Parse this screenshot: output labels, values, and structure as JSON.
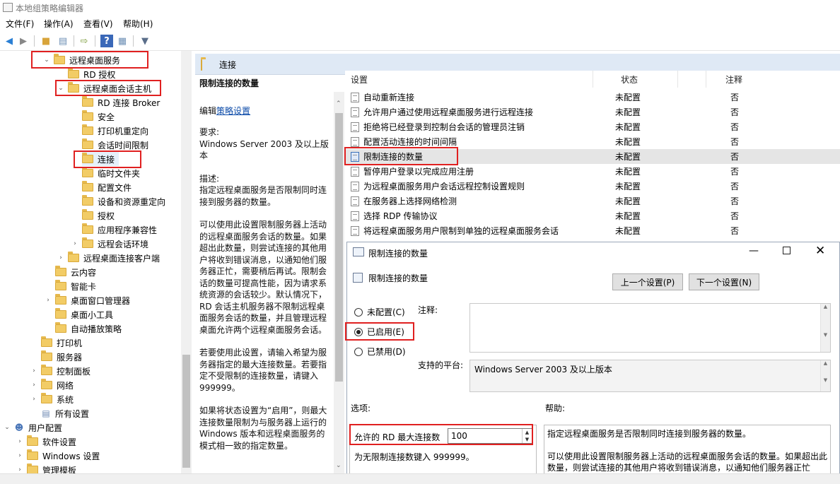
{
  "window": {
    "title": "本地组策略编辑器"
  },
  "menu": [
    "文件(F)",
    "操作(A)",
    "查看(V)",
    "帮助(H)"
  ],
  "toolbar": {
    "icons": [
      "back-icon",
      "forward-icon",
      "up-folder-icon",
      "show-hide-tree-icon",
      "export-icon",
      "help-icon",
      "console-tree-icon",
      "filter-icon"
    ]
  },
  "tree": {
    "items": [
      {
        "label": "远程桌面服务",
        "expanded": true
      },
      {
        "label": "RD 授权"
      },
      {
        "label": "远程桌面会话主机",
        "expanded": true
      },
      {
        "label": "RD 连接 Broker"
      },
      {
        "label": "安全"
      },
      {
        "label": "打印机重定向"
      },
      {
        "label": "会话时间限制"
      },
      {
        "label": "连接",
        "selected": true
      },
      {
        "label": "临时文件夹"
      },
      {
        "label": "配置文件"
      },
      {
        "label": "设备和资源重定向"
      },
      {
        "label": "授权"
      },
      {
        "label": "应用程序兼容性"
      },
      {
        "label": "远程会话环境"
      },
      {
        "label": "远程桌面连接客户端"
      },
      {
        "label": "云内容"
      },
      {
        "label": "智能卡"
      },
      {
        "label": "桌面窗口管理器"
      },
      {
        "label": "桌面小工具"
      },
      {
        "label": "自动播放策略"
      },
      {
        "label": "打印机"
      },
      {
        "label": "服务器"
      },
      {
        "label": "控制面板"
      },
      {
        "label": "网络"
      },
      {
        "label": "系统"
      },
      {
        "label": "所有设置"
      },
      {
        "label": "用户配置"
      },
      {
        "label": "软件设置"
      },
      {
        "label": "Windows 设置"
      },
      {
        "label": "管理模板"
      }
    ]
  },
  "panel": {
    "header": "连接",
    "policy_title": "限制连接的数量",
    "edit_prefix": "编辑",
    "edit_link": "策略设置",
    "req_label": "要求:",
    "req_text": "Windows Server 2003 及以上版本",
    "desc_label": "描述:",
    "desc_1": "指定远程桌面服务是否限制同时连接到服务器的数量。",
    "desc_2": "可以使用此设置限制服务器上活动的远程桌面服务会话的数量。如果超出此数量，则尝试连接的其他用户将收到错误消息，以通知他们服务器正忙，需要稍后再试。限制会话的数量可提高性能，因为请求系统资源的会话较少。默认情况下，RD 会话主机服务器不限制远程桌面服务会话的数量，并且管理远程桌面允许两个远程桌面服务会话。",
    "desc_3": "若要使用此设置，请输入希望为服务器指定的最大连接数量。若要指定不受限制的连接数量，请键入 999999。",
    "desc_4": "如果将状态设置为“启用”，则最大连接数量限制为与服务器上运行的 Windows 版本和远程桌面服务的模式相一致的指定数量。"
  },
  "list": {
    "columns": [
      "设置",
      "状态",
      "注释"
    ],
    "rows": [
      {
        "name": "自动重新连接",
        "state": "未配置",
        "note": "否"
      },
      {
        "name": "允许用户通过使用远程桌面服务进行远程连接",
        "state": "未配置",
        "note": "否"
      },
      {
        "name": "拒绝将已经登录到控制台会话的管理员注销",
        "state": "未配置",
        "note": "否"
      },
      {
        "name": "配置活动连接的时间间隔",
        "state": "未配置",
        "note": "否"
      },
      {
        "name": "限制连接的数量",
        "state": "未配置",
        "note": "否",
        "selected": true
      },
      {
        "name": "暂停用户登录以完成应用注册",
        "state": "未配置",
        "note": "否"
      },
      {
        "name": "为远程桌面服务用户会话远程控制设置规则",
        "state": "未配置",
        "note": "否"
      },
      {
        "name": "在服务器上选择网络检测",
        "state": "未配置",
        "note": "否"
      },
      {
        "name": "选择 RDP 传输协议",
        "state": "未配置",
        "note": "否"
      },
      {
        "name": "将远程桌面服务用户限制到单独的远程桌面服务会话",
        "state": "未配置",
        "note": "否"
      }
    ]
  },
  "dialog": {
    "title": "限制连接的数量",
    "policy_name": "限制连接的数量",
    "prev_button": "上一个设置(P)",
    "next_button": "下一个设置(N)",
    "opt_not_configured": "未配置(C)",
    "opt_enabled": "已启用(E)",
    "opt_disabled": "已禁用(D)",
    "selected_option": "enabled",
    "comment_label": "注释:",
    "platform_label": "支持的平台:",
    "platform_value": "Windows Server 2003 及以上版本",
    "options_label": "选项:",
    "help_label": "帮助:",
    "max_conn_label": "允许的 RD 最大连接数",
    "max_conn_value": "100",
    "unlimited_hint": "为无限制连接数键入 999999。",
    "help_text_1": "指定远程桌面服务是否限制同时连接到服务器的数量。",
    "help_text_2": "可以使用此设置限制服务器上活动的远程桌面服务会话的数量。如果超出此数量，则尝试连接的其他用户将收到错误消息，以通知他们服务器正忙"
  },
  "colors": {
    "highlight": "#e02020",
    "header_bg": "#dfe9f5",
    "selected_row": "#e5e5e5"
  }
}
